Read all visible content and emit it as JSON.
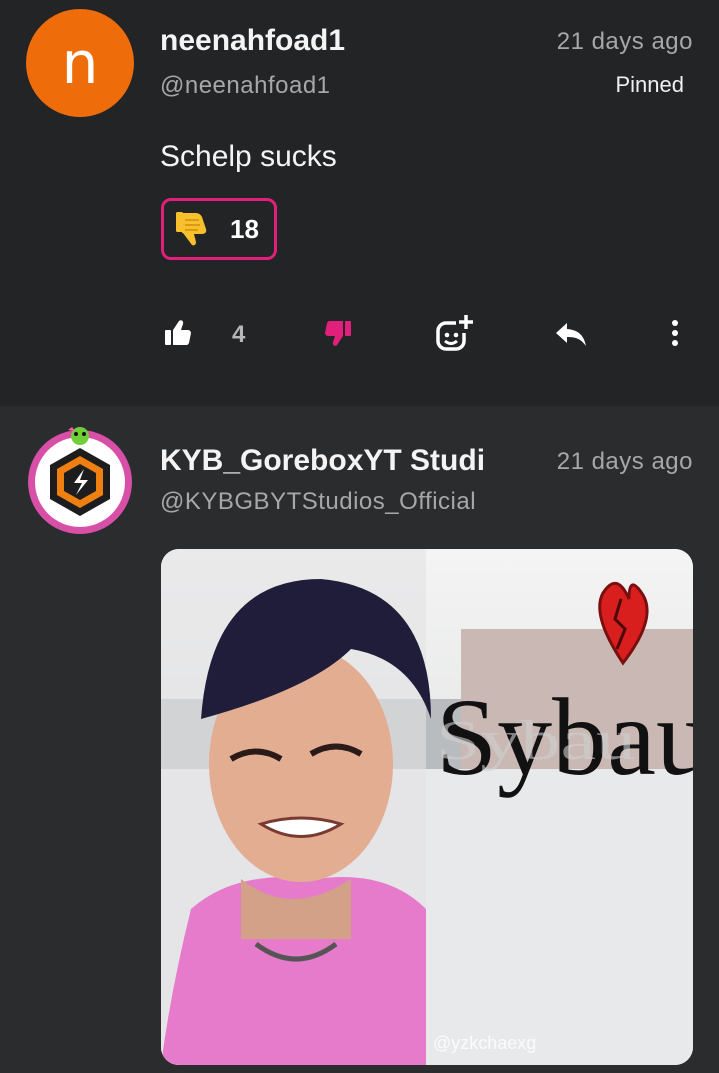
{
  "comments": [
    {
      "avatar_letter": "n",
      "avatar_color": "#ef6c0a",
      "username": "neenahfoad1",
      "handle": "@neenahfoad1",
      "time": "21 days ago",
      "pinned_label": "Pinned",
      "text": "Schelp sucks",
      "reaction": {
        "icon": "thumbs-down-emoji",
        "count": "18"
      },
      "actions": {
        "like_count": "4"
      },
      "accent_color": "#e0207a"
    },
    {
      "username": "KYB_GoreboxYT Studi",
      "handle": "@KYBGBYTStudios_Official",
      "time": "21 days ago",
      "attachment": {
        "caption": "Sybau",
        "watermark": "@yzkchaexg"
      }
    }
  ]
}
